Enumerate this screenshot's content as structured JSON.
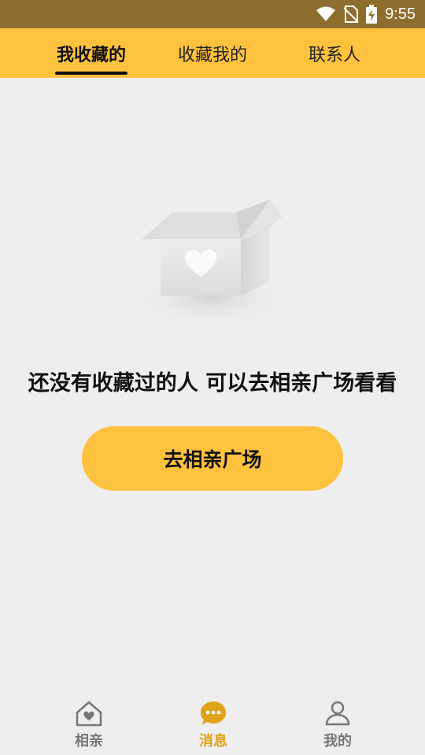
{
  "status_bar": {
    "time": "9:55",
    "icons": [
      "wifi-icon",
      "no-sim-icon",
      "battery-charging-icon"
    ]
  },
  "tabs": [
    {
      "label": "我收藏的",
      "active": true
    },
    {
      "label": "收藏我的",
      "active": false
    },
    {
      "label": "联系人",
      "active": false
    }
  ],
  "empty_state": {
    "illustration": "empty-box-heart-icon",
    "message": "还没有收藏过的人 可以去相亲广场看看",
    "button_label": "去相亲广场"
  },
  "bottom_nav": [
    {
      "label": "相亲",
      "icon": "house-heart-icon",
      "active": false
    },
    {
      "label": "消息",
      "icon": "chat-bubble-icon",
      "active": true
    },
    {
      "label": "我的",
      "icon": "person-icon",
      "active": false
    }
  ],
  "colors": {
    "accent": "#ffc23f",
    "status_bar": "#8d6e2e",
    "active_nav": "#e0a21a",
    "background": "#eeeeee"
  }
}
